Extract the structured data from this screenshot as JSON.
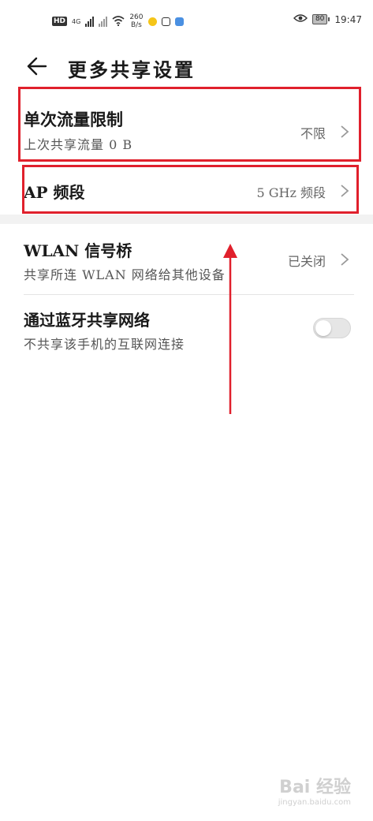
{
  "status_bar": {
    "hd_label": "HD",
    "network_label": "4G",
    "net_speed_value": "260",
    "net_speed_unit": "B/s",
    "battery_level": "80",
    "time": "19:47"
  },
  "header": {
    "title": "更多共享设置"
  },
  "rows": {
    "single_traffic_limit": {
      "title": "单次流量限制",
      "subtitle": "上次共享流量 0 B",
      "value": "不限"
    },
    "ap_band": {
      "title": "AP 频段",
      "value": "5 GHz 频段"
    },
    "wlan_bridge": {
      "title": "WLAN 信号桥",
      "subtitle": "共享所连 WLAN 网络给其他设备",
      "value": "已关闭"
    },
    "bluetooth_share": {
      "title": "通过蓝牙共享网络",
      "subtitle": "不共享该手机的互联网连接",
      "toggle_on": false
    }
  },
  "watermark": {
    "text": "Bai 经验",
    "sub": "jingyan.baidu.com"
  },
  "colors": {
    "annotation": "#e0202c",
    "background": "#ffffff"
  }
}
